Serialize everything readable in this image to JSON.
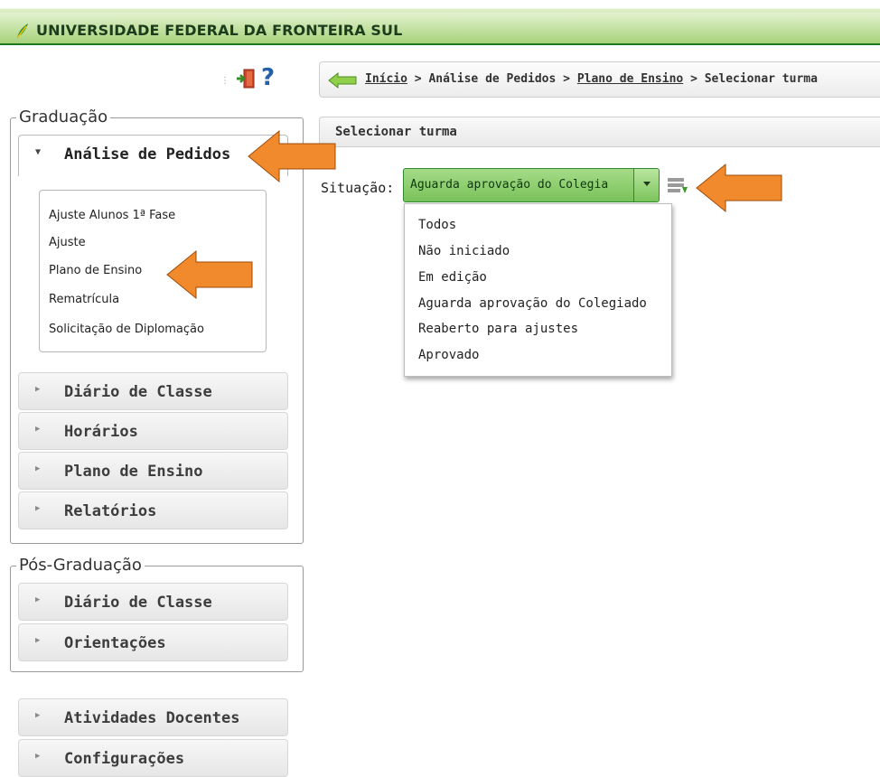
{
  "header": {
    "title": "UNIVERSIDADE FEDERAL DA FRONTEIRA SUL"
  },
  "toolbar": {
    "exit_icon": "exit-door-icon",
    "help_label": "?"
  },
  "breadcrumb": {
    "home": "Início",
    "sep": ">",
    "analise": "Análise de Pedidos",
    "plano": "Plano de Ensino",
    "current": "Selecionar turma"
  },
  "sidebar": {
    "graduacao": {
      "legend": "Graduação",
      "active": "Análise de Pedidos",
      "submenu": [
        "Ajuste Alunos 1ª Fase",
        "Ajuste",
        "Plano de Ensino",
        "Rematrícula",
        "Solicitação de Diplomação"
      ],
      "items": [
        "Diário de Classe",
        "Horários",
        "Plano de Ensino",
        "Relatórios"
      ]
    },
    "posgraduacao": {
      "legend": "Pós-Graduação",
      "items": [
        "Diário de Classe",
        "Orientações"
      ]
    },
    "extra": [
      "Atividades Docentes",
      "Configurações"
    ]
  },
  "main": {
    "panel_title": "Selecionar turma",
    "situacao_label": "Situação:",
    "select_value": "Aguarda aprovação do Colegia",
    "options": [
      "Todos",
      "Não iniciado",
      "Em edição",
      "Aguarda aprovação do Colegiado",
      "Reaberto para ajustes",
      "Aprovado"
    ]
  },
  "colors": {
    "accent_orange": "#f08a2c",
    "header_green": "#a9d37b",
    "select_green": "#8dcf6c"
  }
}
